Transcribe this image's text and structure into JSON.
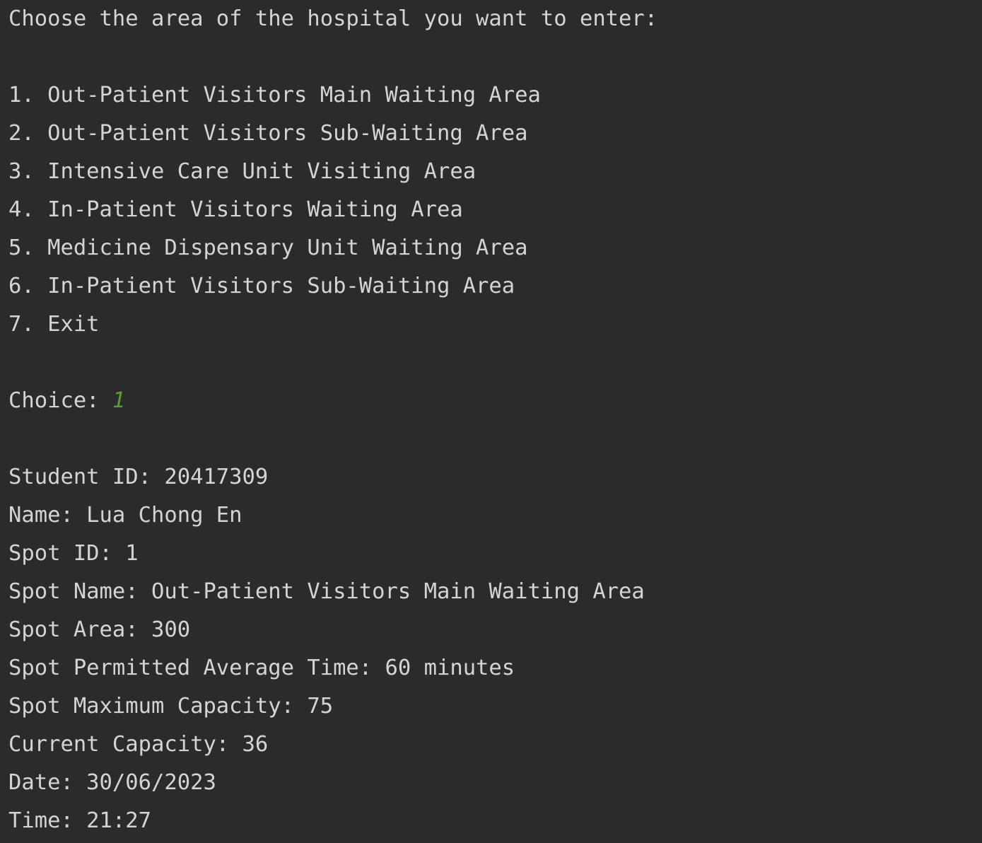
{
  "prompt": "Choose the area of the hospital you want to enter:",
  "menu": [
    "1. Out-Patient Visitors Main Waiting Area",
    "2. Out-Patient Visitors Sub-Waiting Area",
    "3. Intensive Care Unit Visiting Area",
    "4. In-Patient Visitors Waiting Area",
    "5. Medicine Dispensary Unit Waiting Area",
    "6. In-Patient Visitors Sub-Waiting Area",
    "7. Exit"
  ],
  "choice": {
    "label": "Choice: ",
    "value": "1",
    "value_color": "#5a9e32"
  },
  "details": [
    "Student ID: 20417309",
    "Name: Lua Chong En",
    "Spot ID: 1",
    "Spot Name: Out-Patient Visitors Main Waiting Area",
    "Spot Area: 300",
    "Spot Permitted Average Time: 60 minutes",
    "Spot Maximum Capacity: 75",
    "Current Capacity: 36",
    "Date: 30/06/2023",
    "Time: 21:27"
  ],
  "colors": {
    "background": "#2b2b2b",
    "text": "#d4d4d4"
  }
}
